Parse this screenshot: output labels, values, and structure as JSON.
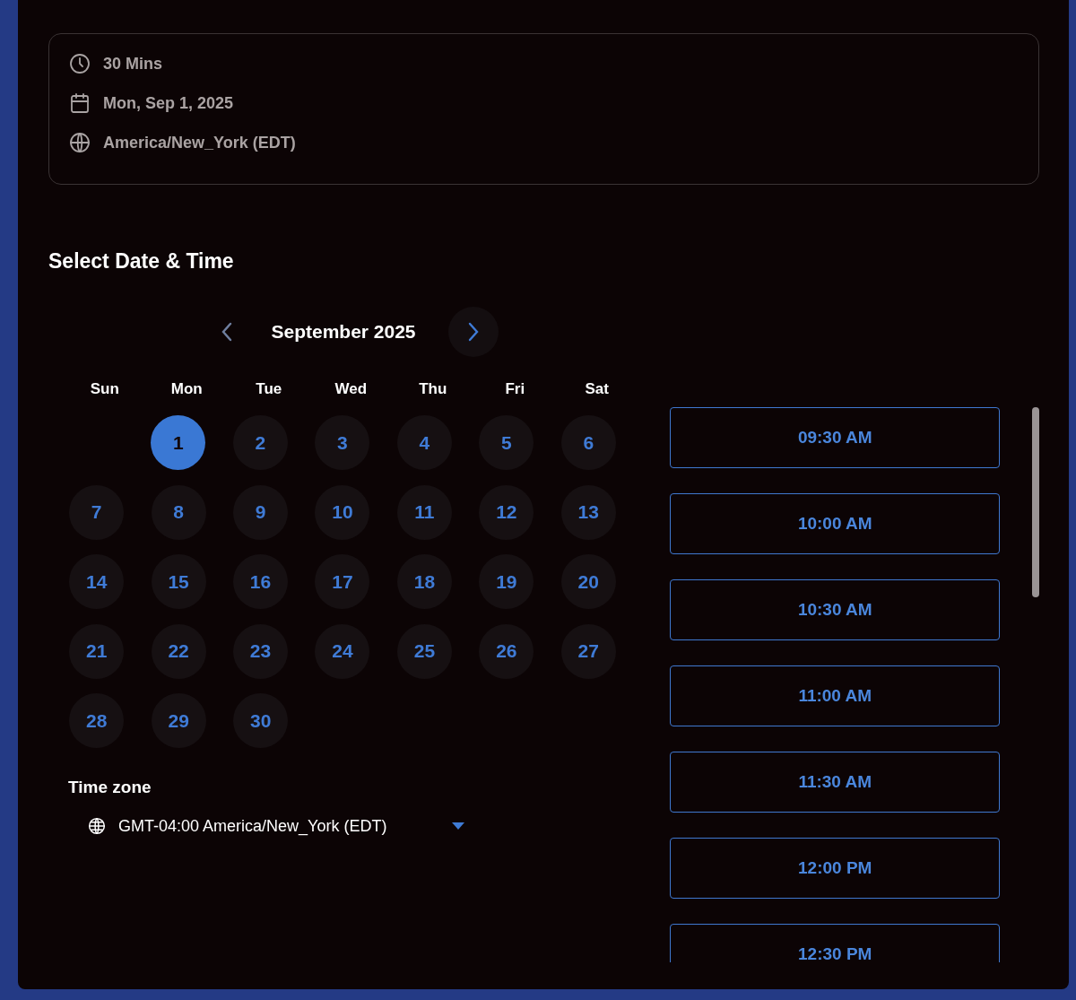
{
  "summary": {
    "items": [
      {
        "kind": "duration",
        "text": "30 Mins"
      },
      {
        "kind": "date",
        "text": "Mon, Sep 1, 2025"
      },
      {
        "kind": "timezone",
        "text": "America/New_York (EDT)"
      }
    ]
  },
  "heading": "Select Date & Time",
  "calendar": {
    "month": "September 2025",
    "weekdays": [
      "Sun",
      "Mon",
      "Tue",
      "Wed",
      "Thu",
      "Fri",
      "Sat"
    ],
    "weeks": [
      {
        "days": [
          {
            "label": "1",
            "selected": true
          },
          {
            "label": "2",
            "selected": false
          },
          {
            "label": "3",
            "selected": false
          },
          {
            "label": "4",
            "selected": false
          },
          {
            "label": "5",
            "selected": false
          },
          {
            "label": "6",
            "selected": false
          }
        ]
      },
      {
        "days": [
          {
            "label": "7",
            "selected": false
          },
          {
            "label": "8",
            "selected": false
          },
          {
            "label": "9",
            "selected": false
          },
          {
            "label": "10",
            "selected": false
          },
          {
            "label": "11",
            "selected": false
          },
          {
            "label": "12",
            "selected": false
          },
          {
            "label": "13",
            "selected": false
          }
        ]
      },
      {
        "days": [
          {
            "label": "14",
            "selected": false
          },
          {
            "label": "15",
            "selected": false
          },
          {
            "label": "16",
            "selected": false
          },
          {
            "label": "17",
            "selected": false
          },
          {
            "label": "18",
            "selected": false
          },
          {
            "label": "19",
            "selected": false
          },
          {
            "label": "20",
            "selected": false
          }
        ]
      },
      {
        "days": [
          {
            "label": "21",
            "selected": false
          },
          {
            "label": "22",
            "selected": false
          },
          {
            "label": "23",
            "selected": false
          },
          {
            "label": "24",
            "selected": false
          },
          {
            "label": "25",
            "selected": false
          },
          {
            "label": "26",
            "selected": false
          },
          {
            "label": "27",
            "selected": false
          }
        ]
      },
      {
        "days": [
          {
            "label": "28",
            "selected": false
          },
          {
            "label": "29",
            "selected": false
          },
          {
            "label": "30",
            "selected": false
          }
        ]
      }
    ]
  },
  "time_zone": {
    "label": "Time zone",
    "value": "GMT-04:00 America/New_York (EDT)"
  },
  "slots": [
    "09:30 AM",
    "10:00 AM",
    "10:30 AM",
    "11:00 AM",
    "11:30 AM",
    "12:00 PM",
    "12:30 PM"
  ]
}
